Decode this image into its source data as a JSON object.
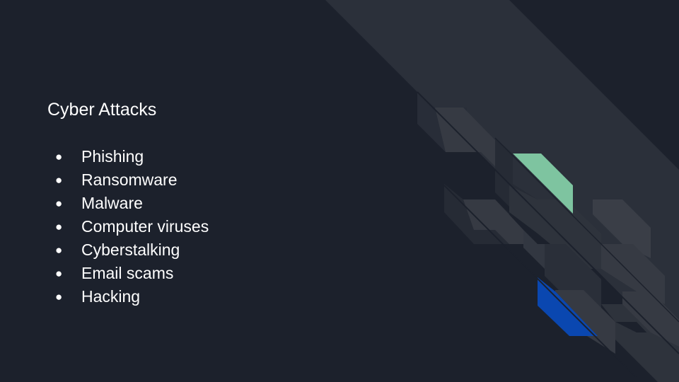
{
  "slide": {
    "title": "Cyber Attacks",
    "bullet_glyph": "●",
    "bullets": [
      "Phishing",
      "Ransomware",
      "Malware",
      "Computer viruses",
      "Cyberstalking",
      "Email scams",
      "Hacking"
    ]
  },
  "colors": {
    "background": "#1c212c",
    "text": "#ffffff",
    "stripe": "#2b303a",
    "tile": "#363a43",
    "accent_green": "#7ec4a0",
    "accent_blue": "#0a47b0"
  }
}
